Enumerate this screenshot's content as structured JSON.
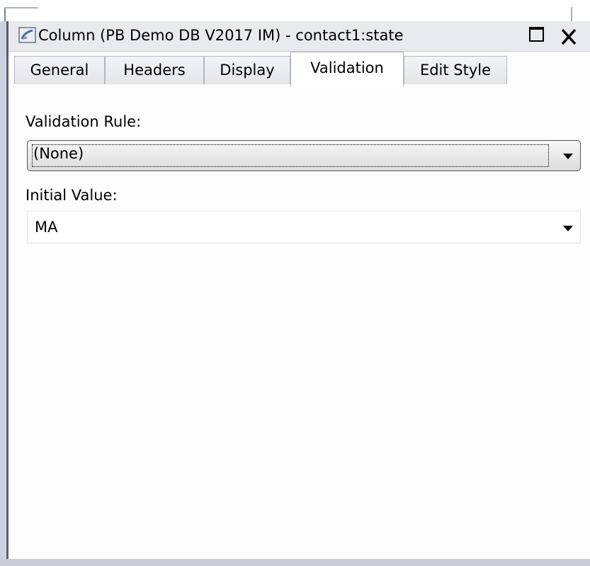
{
  "window": {
    "title": "Column (PB Demo DB V2017 IM) - contact1:state",
    "icons": {
      "app": "column-painter-icon",
      "maximize": "maximize-icon",
      "close": "close-icon"
    }
  },
  "tabs": [
    {
      "label": "General",
      "active": false
    },
    {
      "label": "Headers",
      "active": false
    },
    {
      "label": "Display",
      "active": false
    },
    {
      "label": "Validation",
      "active": true
    },
    {
      "label": "Edit Style",
      "active": false
    }
  ],
  "validation_rule": {
    "label": "Validation Rule:",
    "value": "(None)",
    "icon": "chevron-down-icon"
  },
  "initial_value": {
    "label": "Initial Value:",
    "value": "MA",
    "icon": "chevron-down-icon"
  },
  "colors": {
    "titlebar": "#e8eaee",
    "tab_inactive": "#e3e5e9",
    "tab_active": "#ffffff",
    "border": "#b3b8c0"
  }
}
